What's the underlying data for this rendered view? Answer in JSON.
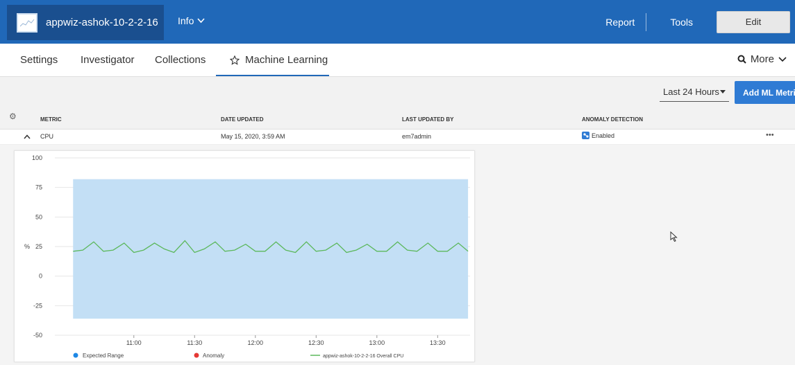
{
  "app": {
    "title": "appwiz-ashok-10-2-2-16",
    "info_label": "Info",
    "report_label": "Report",
    "tools_label": "Tools",
    "edit_label": "Edit",
    "icons": [
      "graph-thumbnail-icon",
      "chevron-down-icon"
    ]
  },
  "tabs": {
    "items": [
      "Settings",
      "Investigator",
      "Collections",
      "Machine Learning"
    ],
    "active": "Machine Learning",
    "active_icon": "star-icon",
    "more_label": "More"
  },
  "toolbar": {
    "range_label": "Last 24 Hours",
    "add_ml_label": "Add ML Metric"
  },
  "table": {
    "headers": [
      "METRIC",
      "DATE UPDATED",
      "LAST UPDATED BY",
      "ANOMALY DETECTION"
    ],
    "rows": [
      {
        "metric": "CPU",
        "date_updated": "May 15, 2020, 3:59 AM",
        "last_updated_by": "em7admin",
        "anomaly_detection": "Enabled",
        "actions": "•••"
      }
    ]
  },
  "colors": {
    "topbar": "#2068b8",
    "app_block": "#1a4f8f",
    "accent": "#2f7bd4",
    "expected_range": "#c3dff5",
    "cpu_line": "#5cb85c",
    "legend_expected": "#1e88e5",
    "legend_anomaly": "#e53935"
  },
  "chart_data": {
    "type": "area",
    "ylabel": "%",
    "ylim": [
      -50,
      100
    ],
    "yticks": [
      "100",
      "75",
      "50",
      "25",
      "0",
      "-25",
      "-50"
    ],
    "xticks": [
      "11:00",
      "11:30",
      "12:00",
      "12:30",
      "13:00",
      "13:30"
    ],
    "x_range_minutes": [
      -39,
      166
    ],
    "expected_range": {
      "lower": -36,
      "upper": 82,
      "x_start": 10.5,
      "x_end": 13.75
    },
    "series": [
      {
        "name": "appwiz-ashok-10-2-2-16 Overall CPU",
        "x": [
          10.5,
          10.58,
          10.67,
          10.75,
          10.83,
          10.92,
          11.0,
          11.08,
          11.17,
          11.25,
          11.33,
          11.42,
          11.5,
          11.58,
          11.67,
          11.75,
          11.83,
          11.92,
          12.0,
          12.08,
          12.17,
          12.25,
          12.33,
          12.42,
          12.5,
          12.58,
          12.67,
          12.75,
          12.83,
          12.92,
          13.0,
          13.08,
          13.17,
          13.25,
          13.33,
          13.42,
          13.5,
          13.58,
          13.67,
          13.75
        ],
        "values": [
          21,
          22,
          29,
          21,
          22,
          28,
          20,
          22,
          28,
          23,
          20,
          30,
          20,
          23,
          29,
          21,
          22,
          27,
          21,
          21,
          29,
          22,
          20,
          29,
          21,
          22,
          28,
          20,
          22,
          27,
          21,
          21,
          29,
          22,
          21,
          28,
          21,
          21,
          28,
          21
        ]
      }
    ],
    "legend": [
      {
        "label": "Expected Range",
        "color": "#1e88e5"
      },
      {
        "label": "Anomaly",
        "color": "#e53935"
      },
      {
        "label": "appwiz-ashok-10-2-2-16 Overall CPU",
        "color": "#5cb85c"
      }
    ],
    "legend_position": "bottom",
    "grid": true
  }
}
